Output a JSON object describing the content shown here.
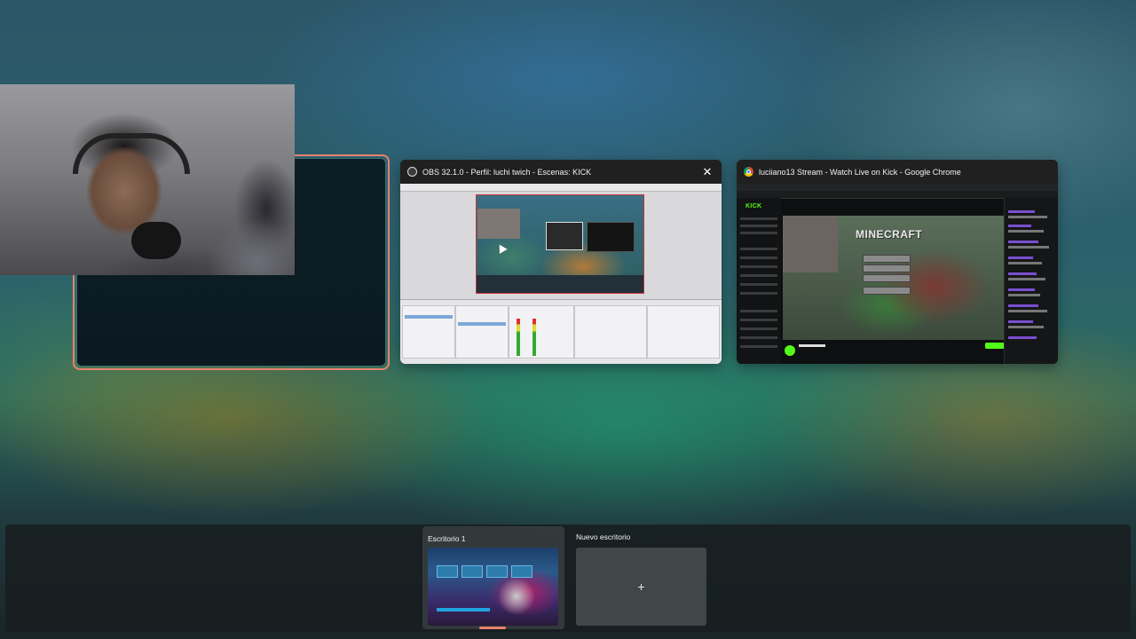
{
  "windows": [
    {
      "app": "OBS",
      "title": "OBS 32.1.0 - Perfil: luchi twich - Escenas: KICK",
      "close_glyph": "✕"
    },
    {
      "app": "Google Chrome",
      "title": "luciiano13 Stream - Watch Live on Kick - Google Chrome",
      "page": {
        "logo": "KICK",
        "stream_title": "MINECRAFT"
      }
    }
  ],
  "desktops": {
    "items": [
      {
        "label": "Escritorio 1",
        "active": true
      },
      {
        "label": "Nuevo escritorio",
        "add_glyph": "+"
      }
    ]
  },
  "colors": {
    "selection_border": "#e8826f",
    "kick_green": "#53fc18"
  },
  "icons": [
    "obs-icon",
    "chrome-icon",
    "close-icon",
    "plus-icon"
  ]
}
